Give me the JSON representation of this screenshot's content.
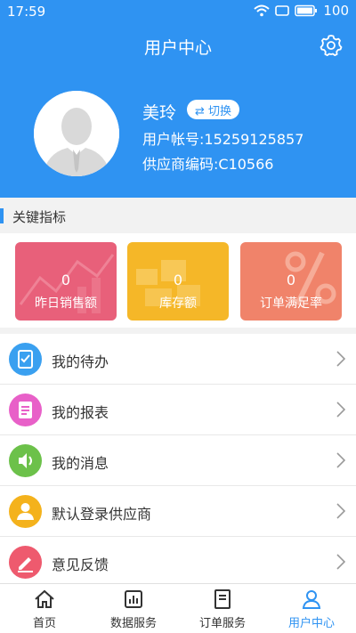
{
  "status_bar": {
    "time": "17:59",
    "battery": "100"
  },
  "header": {
    "title": "用户中心",
    "user_name": "美玲",
    "switch_label": "⇄ 切换",
    "account": "用户帐号:15259125857",
    "supplier_code": "供应商编码:C10566"
  },
  "metrics": {
    "section_title": "关键指标",
    "cards": [
      {
        "value": "0",
        "label": "昨日销售额"
      },
      {
        "value": "0",
        "label": "库存额"
      },
      {
        "value": "0",
        "label": "订单满足率"
      }
    ]
  },
  "menu": {
    "items": [
      {
        "label": "我的待办",
        "icon": "todo-icon",
        "color": "#3aa0f0"
      },
      {
        "label": "我的报表",
        "icon": "report-icon",
        "color": "#e860c8"
      },
      {
        "label": "我的消息",
        "icon": "message-icon",
        "color": "#6cc14a"
      },
      {
        "label": "默认登录供应商",
        "icon": "supplier-icon",
        "color": "#f4b21c"
      },
      {
        "label": "意见反馈",
        "icon": "feedback-icon",
        "color": "#ee5a6e"
      }
    ]
  },
  "tabs": [
    {
      "label": "首页",
      "icon": "home-icon"
    },
    {
      "label": "数据服务",
      "icon": "chart-icon"
    },
    {
      "label": "订单服务",
      "icon": "document-icon"
    },
    {
      "label": "用户中心",
      "icon": "user-icon",
      "active": true
    }
  ],
  "colors": {
    "primary": "#2f93f2",
    "card_sales": "#e8607a",
    "card_stock": "#f5b728",
    "card_order": "#f0836a"
  }
}
